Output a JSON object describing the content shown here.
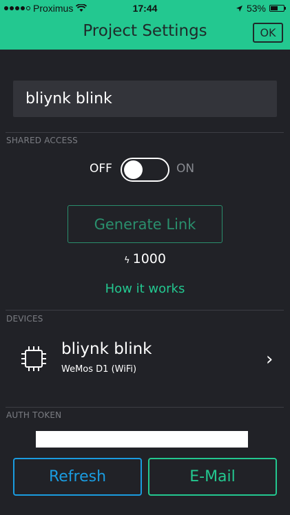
{
  "status_bar": {
    "carrier": "Proximus",
    "time": "17:44",
    "battery_percent": "53%",
    "battery_level": 0.53,
    "signal_bars_filled": 4,
    "signal_bars_total": 5
  },
  "header": {
    "title": "Project Settings",
    "ok_label": "OK",
    "background_color": "#23c890"
  },
  "project": {
    "name": "bliynk blink"
  },
  "shared_access": {
    "section_label": "SHARED ACCESS",
    "toggle_off_label": "OFF",
    "toggle_on_label": "ON",
    "enabled": false,
    "generate_link_label": "Generate Link",
    "energy_value": "1000",
    "how_it_works_label": "How it works"
  },
  "devices": {
    "section_label": "DEVICES",
    "items": [
      {
        "name": "bliynk blink",
        "model": "WeMos D1 (WiFi)",
        "icon": "chip-icon"
      }
    ]
  },
  "auth_token": {
    "section_label": "AUTH TOKEN",
    "value": ""
  },
  "actions": {
    "refresh_label": "Refresh",
    "email_label": "E-Mail",
    "refresh_color": "#1a9ce0",
    "email_color": "#23c890"
  }
}
